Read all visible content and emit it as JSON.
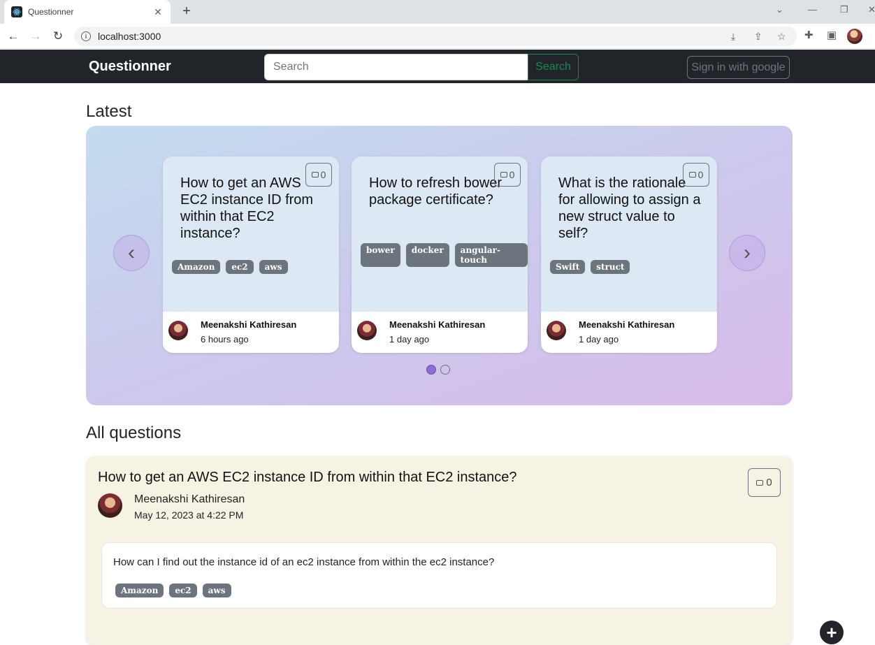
{
  "browser": {
    "tab_title": "Questionner",
    "url": "localhost:3000"
  },
  "navbar": {
    "brand": "Questionner",
    "search_placeholder": "Search",
    "search_button": "Search",
    "signin_button": "Sign in with google"
  },
  "latest": {
    "title": "Latest",
    "cards": [
      {
        "title": "How to get an AWS EC2 instance ID from within that EC2 instance?",
        "comments": "0",
        "tags": [
          "Amazon",
          "ec2",
          "aws"
        ],
        "author": "Meenakshi Kathiresan",
        "time": "6 hours ago"
      },
      {
        "title": "How to refresh bower package certificate?",
        "comments": "0",
        "tags": [
          "bower",
          "docker",
          "angular-touch"
        ],
        "author": "Meenakshi Kathiresan",
        "time": "1 day ago"
      },
      {
        "title": "What is the rationale for allowing to assign a new struct value to self?",
        "comments": "0",
        "tags": [
          "Swift",
          "struct"
        ],
        "author": "Meenakshi Kathiresan",
        "time": "1 day ago"
      }
    ],
    "prev_arrow": "‹",
    "next_arrow": "›",
    "slide_count": 2,
    "active_slide": 1
  },
  "all_questions": {
    "title": "All questions",
    "items": [
      {
        "title": "How to get an AWS EC2 instance ID from within that EC2 instance?",
        "author": "Meenakshi Kathiresan",
        "date": "May 12, 2023 at 4:22 PM",
        "comments": "0",
        "body": "How can I find out the instance id of an ec2 instance from within the ec2 instance?",
        "tags": [
          "Amazon",
          "ec2",
          "aws"
        ]
      }
    ]
  },
  "fab_label": "+"
}
